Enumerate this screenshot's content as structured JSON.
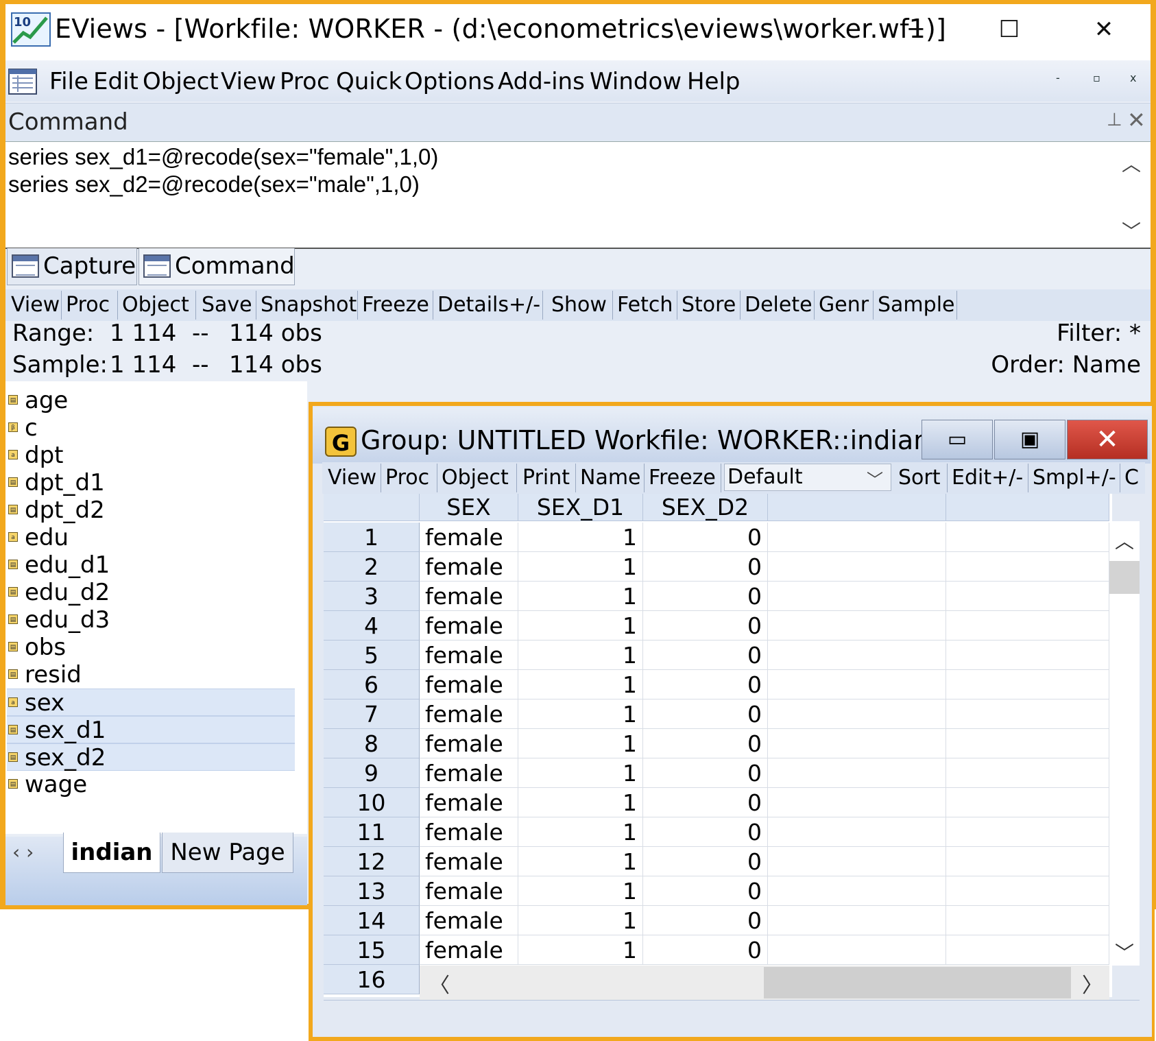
{
  "app": {
    "title": "EViews - [Workfile: WORKER - (d:\\econometrics\\eviews\\worker.wf1)]",
    "logo_text": "10",
    "window_controls": [
      "─",
      "☐",
      "✕"
    ]
  },
  "menu": [
    "File",
    "Edit",
    "Object",
    "View",
    "Proc",
    "Quick",
    "Options",
    "Add-ins",
    "Window",
    "Help"
  ],
  "mdi_controls": [
    "-",
    "▫",
    "x"
  ],
  "command_pane": {
    "title": "Command",
    "lines": [
      "series sex_d1=@recode(sex=\"female\",1,0)",
      "series sex_d2=@recode(sex=\"male\",1,0)"
    ],
    "tabs": [
      "Capture",
      "Command"
    ]
  },
  "workfile": {
    "toolbar": [
      "View",
      "Proc",
      "Object",
      "Save",
      "Snapshot",
      "Freeze",
      "Details+/-",
      "Show",
      "Fetch",
      "Store",
      "Delete",
      "Genr",
      "Sample"
    ],
    "range_label": "Range:",
    "range_value": "1 114",
    "range_sep": "--",
    "range_obs": "114 obs",
    "sample_label": "Sample:",
    "sample_value": "1 114",
    "sample_sep": "--",
    "sample_obs": "114 obs",
    "filter": "Filter: *",
    "order": "Order: Name",
    "objects": [
      {
        "name": "age",
        "icon": "series-icon",
        "selected": false
      },
      {
        "name": "c",
        "icon": "coef-icon",
        "selected": false
      },
      {
        "name": "dpt",
        "icon": "alpha-icon",
        "selected": false
      },
      {
        "name": "dpt_d1",
        "icon": "series-icon",
        "selected": false
      },
      {
        "name": "dpt_d2",
        "icon": "series-icon",
        "selected": false
      },
      {
        "name": "edu",
        "icon": "alpha-icon",
        "selected": false
      },
      {
        "name": "edu_d1",
        "icon": "series-icon",
        "selected": false
      },
      {
        "name": "edu_d2",
        "icon": "series-icon",
        "selected": false
      },
      {
        "name": "edu_d3",
        "icon": "series-icon",
        "selected": false
      },
      {
        "name": "obs",
        "icon": "series-icon",
        "selected": false
      },
      {
        "name": "resid",
        "icon": "series-icon",
        "selected": false
      },
      {
        "name": "sex",
        "icon": "alpha-icon",
        "selected": true
      },
      {
        "name": "sex_d1",
        "icon": "series-icon",
        "selected": true
      },
      {
        "name": "sex_d2",
        "icon": "series-icon",
        "selected": true
      },
      {
        "name": "wage",
        "icon": "series-icon",
        "selected": false
      }
    ],
    "page_tabs": [
      "indian",
      "New Page"
    ],
    "tab_nav": "‹ ›"
  },
  "group": {
    "badge": "G",
    "title": "Group: UNTITLED   Workfile: WORKER::indian\\",
    "toolbar": [
      "View",
      "Proc",
      "Object",
      "Print",
      "Name",
      "Freeze"
    ],
    "view_select": "Default",
    "toolbar_right": [
      "Sort",
      "Edit+/-",
      "Smpl+/-",
      "C"
    ],
    "columns": [
      "SEX",
      "SEX_D1",
      "SEX_D2"
    ],
    "rows": [
      [
        "1",
        "female",
        "1",
        "0"
      ],
      [
        "2",
        "female",
        "1",
        "0"
      ],
      [
        "3",
        "female",
        "1",
        "0"
      ],
      [
        "4",
        "female",
        "1",
        "0"
      ],
      [
        "5",
        "female",
        "1",
        "0"
      ],
      [
        "6",
        "female",
        "1",
        "0"
      ],
      [
        "7",
        "female",
        "1",
        "0"
      ],
      [
        "8",
        "female",
        "1",
        "0"
      ],
      [
        "9",
        "female",
        "1",
        "0"
      ],
      [
        "10",
        "female",
        "1",
        "0"
      ],
      [
        "11",
        "female",
        "1",
        "0"
      ],
      [
        "12",
        "female",
        "1",
        "0"
      ],
      [
        "13",
        "female",
        "1",
        "0"
      ],
      [
        "14",
        "female",
        "1",
        "0"
      ],
      [
        "15",
        "female",
        "1",
        "0"
      ],
      [
        "16",
        "",
        "",
        ""
      ]
    ]
  }
}
